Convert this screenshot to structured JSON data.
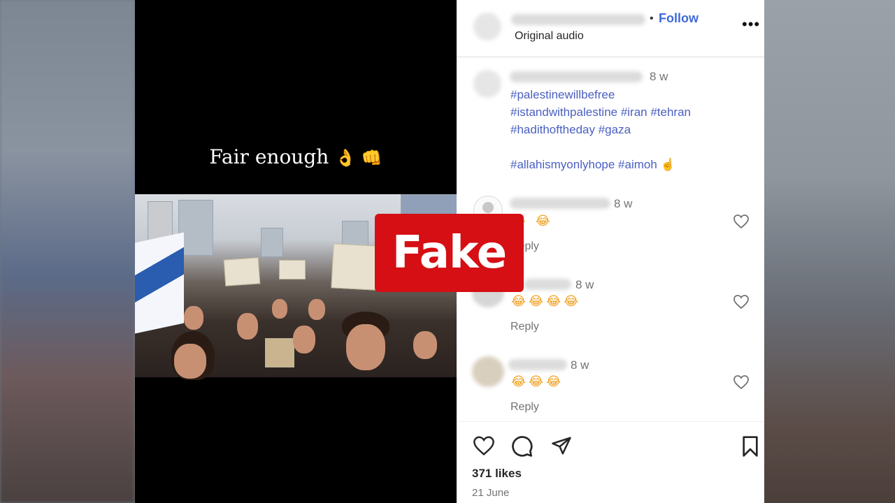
{
  "video": {
    "caption": "Fair enough",
    "caption_emojis": "👌 👊"
  },
  "post": {
    "header": {
      "follow_label": "Follow",
      "audio": "Original audio",
      "more_icon": "more-horizontal-icon"
    },
    "caption_time": "8 w",
    "hashtag_lines": [
      "#palestinewillbefree",
      "#istandwithpalestine #iran #tehran",
      "#hadithoftheday #gaza",
      "#allahismyonlyhope #aimoh ☝"
    ],
    "comments": [
      {
        "time": "8 w",
        "emojis": "😂 😂",
        "reply": "Reply"
      },
      {
        "time": "8 w",
        "emojis": "😂😂😂😂",
        "reply": "Reply"
      },
      {
        "time": "8 w",
        "emojis": "😂😂😂",
        "reply": "Reply"
      }
    ],
    "likes": "371 likes",
    "date": "21 June"
  },
  "overlay": {
    "label": "Fake",
    "color": "#d50f14"
  }
}
